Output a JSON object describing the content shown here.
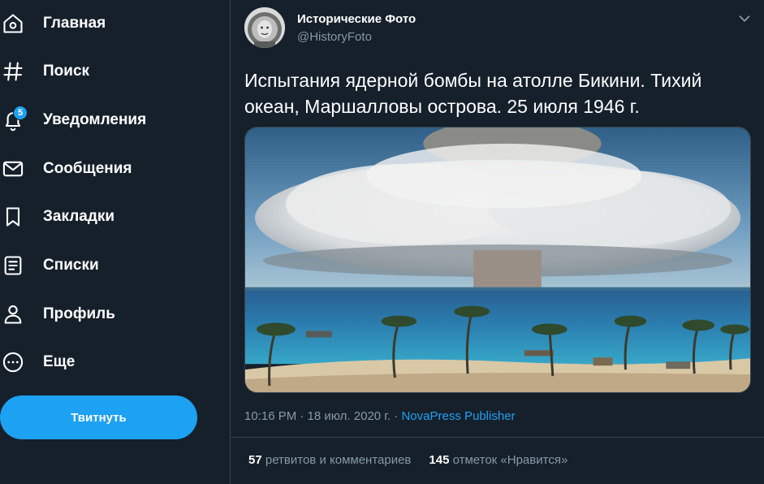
{
  "sidebar": {
    "items": [
      {
        "label": "Главная",
        "icon": "home-icon"
      },
      {
        "label": "Поиск",
        "icon": "hashtag-icon"
      },
      {
        "label": "Уведомления",
        "icon": "bell-icon",
        "badge": "5"
      },
      {
        "label": "Сообщения",
        "icon": "envelope-icon"
      },
      {
        "label": "Закладки",
        "icon": "bookmark-icon"
      },
      {
        "label": "Списки",
        "icon": "list-icon"
      },
      {
        "label": "Профиль",
        "icon": "person-icon"
      },
      {
        "label": "Еще",
        "icon": "more-icon"
      }
    ],
    "tweet_button": "Твитнуть"
  },
  "tweet": {
    "author_name": "Исторические Фото",
    "author_handle": "@HistoryFoto",
    "text": "Испытания ядерной бомбы на атолле Бикини. Тихий океан, Маршалловы острова. 25 июля 1946 г.",
    "time": "10:16 PM · 18 июл. 2020 г.",
    "separator": " · ",
    "source": "NovaPress Publisher",
    "retweets_count": "57",
    "retweets_label": "ретвитов и комментариев",
    "likes_count": "145",
    "likes_label": "отметок «Нравится»"
  },
  "colors": {
    "background": "#15202b",
    "accent": "#1da1f2",
    "secondary_text": "#8899a6",
    "border": "#38444d"
  }
}
